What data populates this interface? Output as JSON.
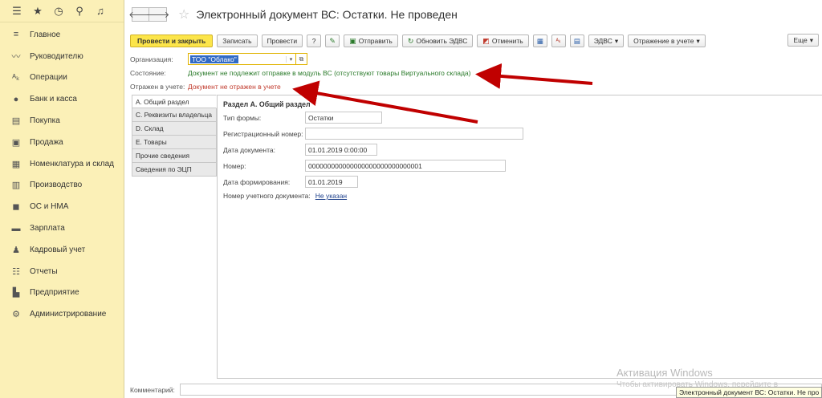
{
  "sidebar": {
    "top_icons": [
      "menu-icon",
      "star-icon",
      "history-icon",
      "search-icon",
      "bell-icon"
    ],
    "items": [
      {
        "label": "Главное",
        "icon": "hamburger-icon"
      },
      {
        "label": "Руководителю",
        "icon": "trend-icon"
      },
      {
        "label": "Операции",
        "icon": "dtkt-icon"
      },
      {
        "label": "Банк и касса",
        "icon": "coin-icon"
      },
      {
        "label": "Покупка",
        "icon": "cart-icon"
      },
      {
        "label": "Продажа",
        "icon": "bag-icon"
      },
      {
        "label": "Номенклатура и склад",
        "icon": "grid-icon"
      },
      {
        "label": "Производство",
        "icon": "factory-icon"
      },
      {
        "label": "ОС и НМА",
        "icon": "truck-icon"
      },
      {
        "label": "Зарплата",
        "icon": "money-icon"
      },
      {
        "label": "Кадровый учет",
        "icon": "people-icon"
      },
      {
        "label": "Отчеты",
        "icon": "list-icon"
      },
      {
        "label": "Предприятие",
        "icon": "building-icon"
      },
      {
        "label": "Администрирование",
        "icon": "gear-icon"
      }
    ]
  },
  "header": {
    "title": "Электронный документ ВС: Остатки. Не проведен"
  },
  "toolbar": {
    "post_close": "Провести и закрыть",
    "save": "Записать",
    "post": "Провести",
    "help": "?",
    "send": "Отправить",
    "update": "Обновить ЭДВС",
    "cancel": "Отменить",
    "edvs": "ЭДВС",
    "reflect": "Отражение в учете",
    "more": "Еще"
  },
  "form": {
    "org_label": "Организация:",
    "org_value": "ТОО \"Облако\"",
    "state_label": "Состояние:",
    "state_value": "Документ не подлежит отправке в модуль ВС (отсутствуют товары Виртуального склада)",
    "reflected_label": "Отражен в учете:",
    "reflected_value": "Документ не отражен в учете"
  },
  "tabs": [
    {
      "label": "А. Общий раздел",
      "active": true
    },
    {
      "label": "С. Реквизиты владельца",
      "active": false
    },
    {
      "label": "D. Склад",
      "active": false
    },
    {
      "label": "Е. Товары",
      "active": false
    },
    {
      "label": "Прочие сведения",
      "active": false
    },
    {
      "label": "Сведения по ЭЦП",
      "active": false
    }
  ],
  "section": {
    "title": "Раздел А. Общий раздел",
    "form_type_label": "Тип формы:",
    "form_type_value": "Остатки",
    "reg_number_label": "Регистрационный номер:",
    "reg_number_value": "",
    "doc_date_label": "Дата документа:",
    "doc_date_value": "01.01.2019  0:00:00",
    "number_label": "Номер:",
    "number_value": "000000000000000000000000000001",
    "form_date_label": "Дата формирования:",
    "form_date_value": "01.01.2019",
    "acc_doc_label": "Номер учетного документа:",
    "acc_doc_value": "Не указан"
  },
  "comment_label": "Комментарий:",
  "watermark": {
    "line1": "Активация Windows",
    "line2": "Чтобы активировать Windows, перейдите в"
  },
  "statusbar": "Электронный документ ВС: Остатки. Не про",
  "colors": {
    "sidebar_bg": "#fbf0b7",
    "primary_button": "#fce54a",
    "state_green": "#2a7a2a",
    "state_red": "#c0392b",
    "arrow": "#c00000"
  }
}
